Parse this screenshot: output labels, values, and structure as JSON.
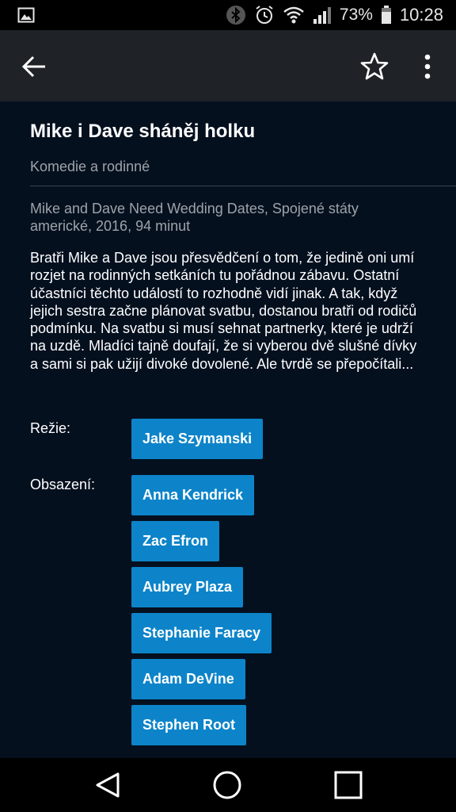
{
  "status_bar": {
    "battery": "73%",
    "time": "10:28",
    "icons": [
      "image-icon",
      "bluetooth-icon",
      "alarm-icon",
      "wifi-icon",
      "signal-icon",
      "battery-icon"
    ]
  },
  "app_bar": {
    "icons": [
      "back-arrow-icon",
      "star-icon",
      "more-vert-icon"
    ]
  },
  "movie": {
    "title": "Mike i Dave sháněj holku",
    "genres": "Komedie a rodinné",
    "meta": "Mike and Dave Need Wedding Dates, Spojené státy americké, 2016, 94 minut",
    "description": "Bratři Mike a Dave jsou přesvědčení o tom, že jedině oni umí rozjet na rodinných setkáních tu pořádnou zábavu. Ostatní účastníci těchto událostí to rozhodně vidí jinak. A tak, když jejich sestra začne plánovat svatbu, dostanou bratři od rodičů podmínku. Na svatbu si musí sehnat partnerky, které je udrží na uzdě. Mladíci tajně doufají, že si vyberou dvě slušné dívky a sami si pak užijí divoké dovolené. Ale tvrdě se přepočítali..."
  },
  "director": {
    "label": "Režie:",
    "names": [
      "Jake Szymanski"
    ]
  },
  "cast": {
    "label": "Obsazení:",
    "names": [
      "Anna Kendrick",
      "Zac Efron",
      "Aubrey Plaza",
      "Stephanie Faracy",
      "Adam DeVine",
      "Stephen Root"
    ]
  },
  "nav_bar": {
    "icons": [
      "nav-back-icon",
      "nav-home-icon",
      "nav-recents-icon"
    ]
  },
  "colors": {
    "accent": "#0d84c9",
    "content_bg": "#05101f",
    "app_bar_bg": "#1f2226"
  }
}
